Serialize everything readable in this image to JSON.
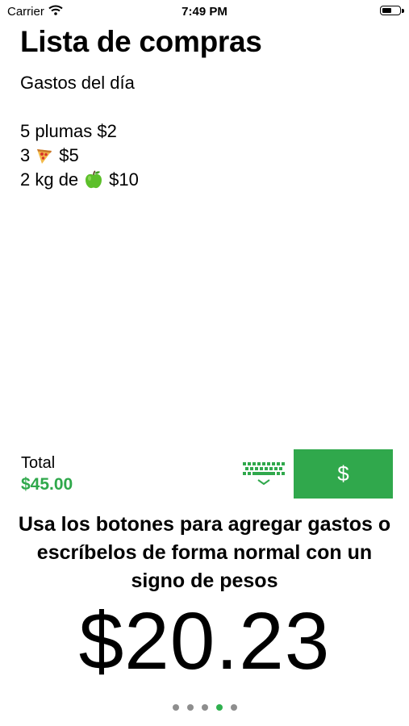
{
  "status_bar": {
    "carrier": "Carrier",
    "time": "7:49 PM",
    "icons": [
      "wifi-icon",
      "battery-icon"
    ]
  },
  "header": {
    "title": "Lista de compras",
    "subtitle": "Gastos del día"
  },
  "items": [
    {
      "text": "5 plumas $2"
    },
    {
      "prefix": "3",
      "emoji": "pizza-emoji",
      "suffix": "$5"
    },
    {
      "prefix": "2 kg de",
      "emoji": "apple-emoji",
      "suffix": "$10"
    }
  ],
  "summary": {
    "total_label": "Total",
    "total_value": "$45.00"
  },
  "controls": {
    "keyboard_icon": "keyboard-icon",
    "dollar_label": "$"
  },
  "onboarding": {
    "instructions": "Usa los botones para agregar gastos o escríbelos de forma normal con un signo de pesos",
    "amount": "$20.23"
  },
  "pagination": {
    "pages": 5,
    "active_index": 3
  },
  "colors": {
    "accent_green": "#30a84c",
    "dot_inactive": "#8e8e8e"
  }
}
